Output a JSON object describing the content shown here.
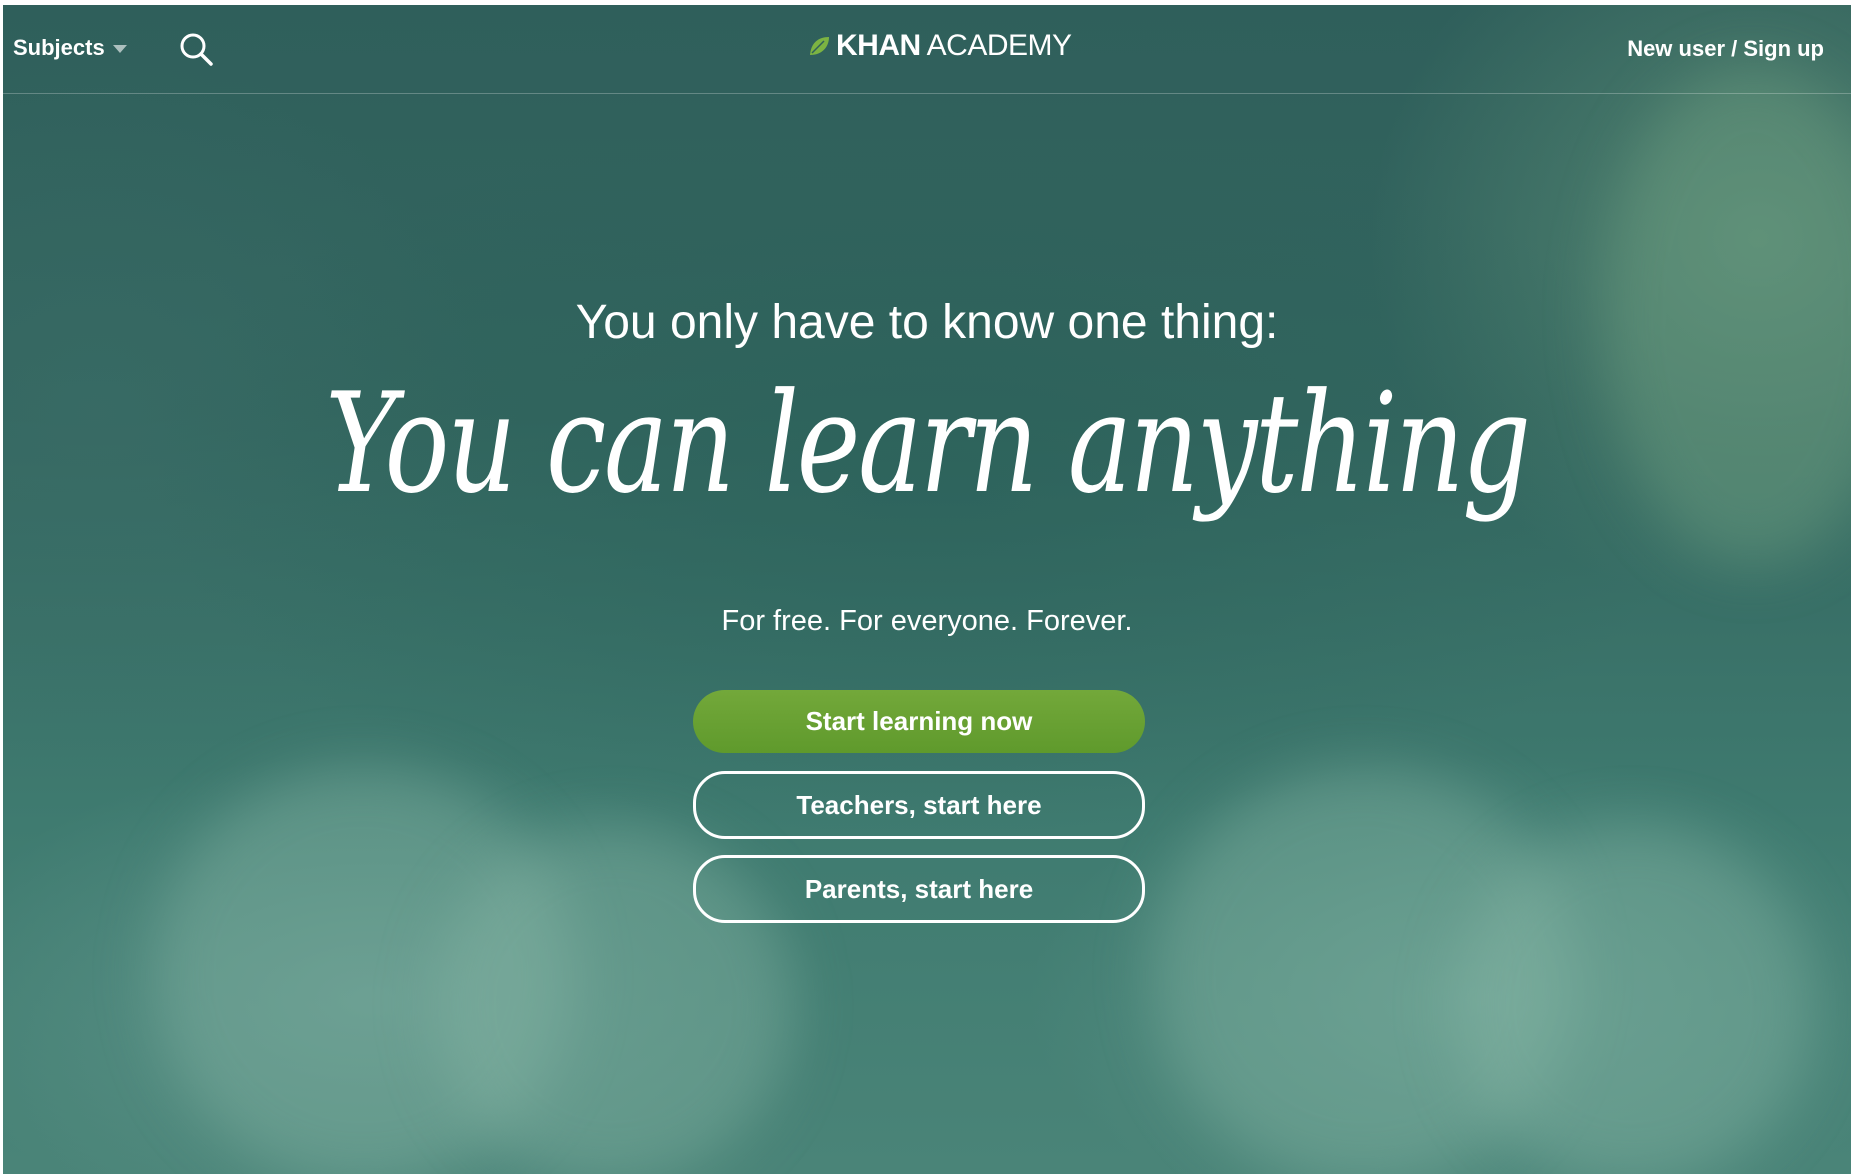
{
  "header": {
    "subjects_label": "Subjects",
    "signup_label": "New user / Sign up",
    "logo": {
      "bold": "KHAN",
      "light": "ACADEMY",
      "leaf_color": "#7cb342"
    }
  },
  "hero": {
    "kicker": "You only have to know one thing:",
    "headline": "You can learn anything",
    "tagline": "For free. For everyone. Forever."
  },
  "buttons": {
    "start": "Start learning now",
    "teachers": "Teachers, start here",
    "parents": "Parents, start here"
  },
  "colors": {
    "primary_button": "#6aa334",
    "background": "#33665f"
  },
  "icons": {
    "search": "search-icon",
    "caret": "chevron-down-icon",
    "leaf": "leaf-icon"
  }
}
